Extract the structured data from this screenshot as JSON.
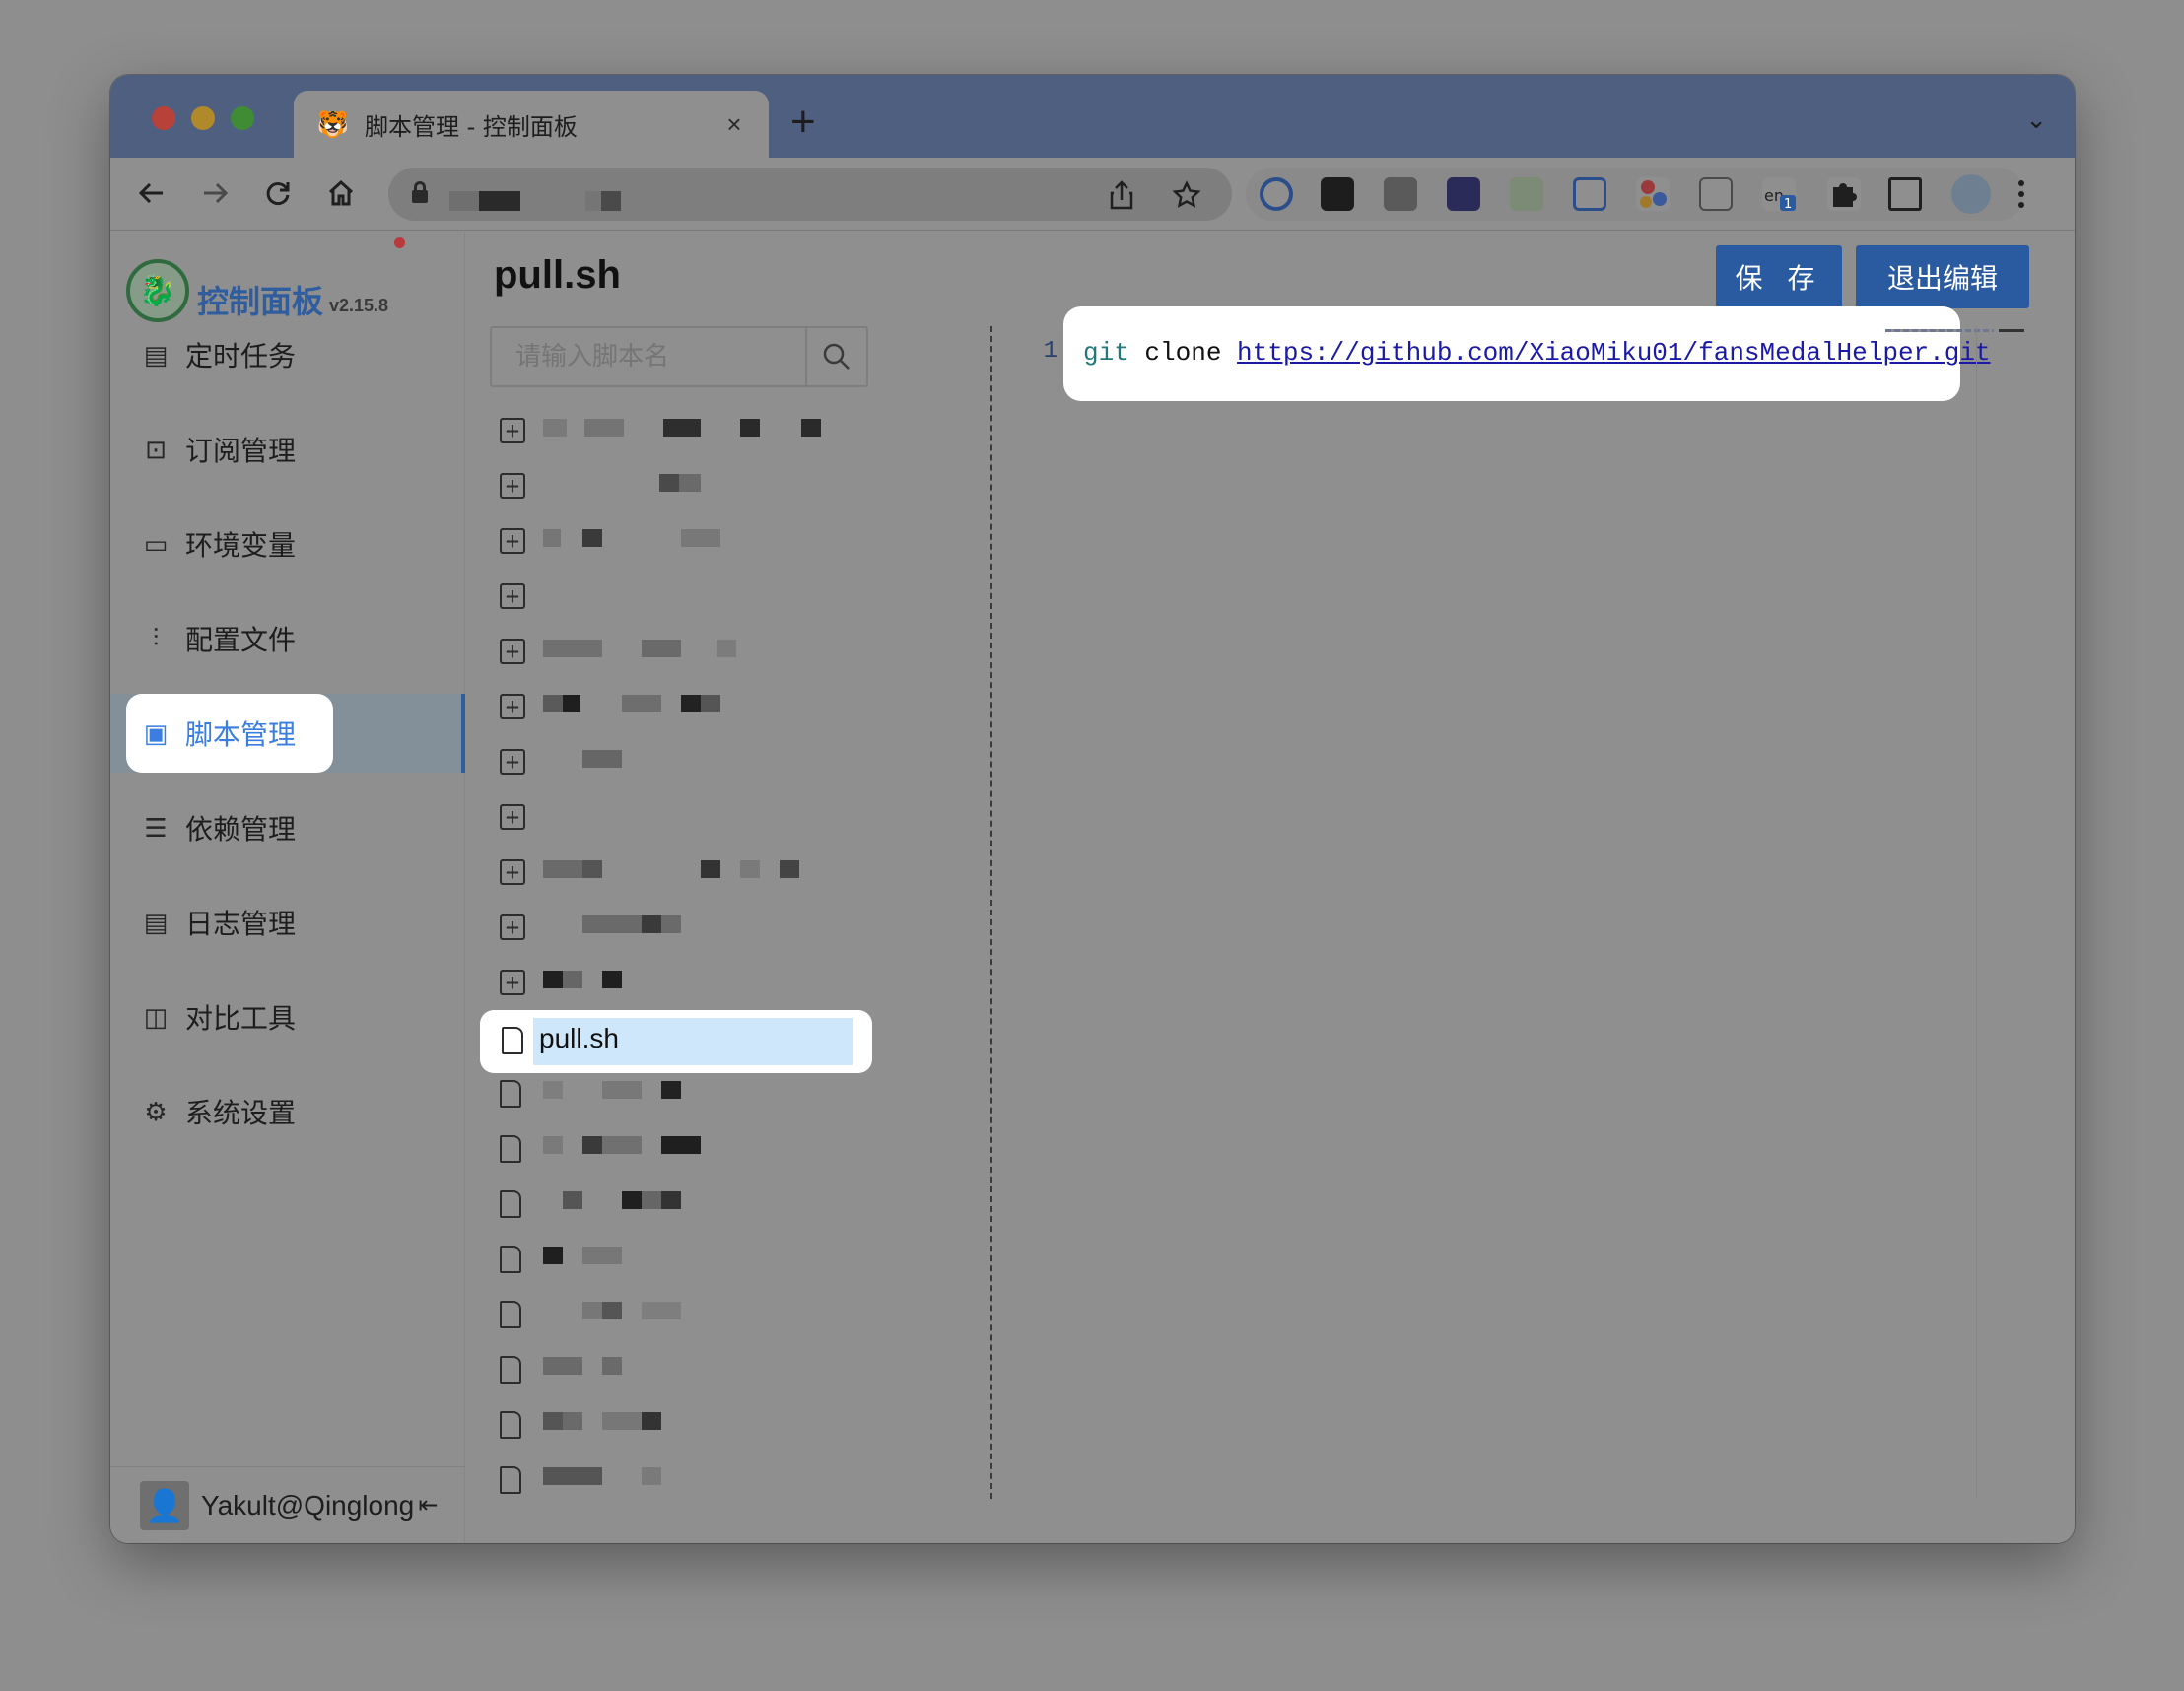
{
  "browser": {
    "tab_title": "脚本管理 - 控制面板",
    "tab_close": "×",
    "new_tab": "+",
    "tab_menu": "⌄"
  },
  "icons": {
    "back": "back-arrow-icon",
    "forward": "forward-arrow-icon",
    "reload": "reload-icon",
    "home": "home-icon",
    "share": "share-icon",
    "bookmark": "star-icon",
    "search": "search-icon"
  },
  "sidebar": {
    "brand": "控制面板",
    "version": "v2.15.8",
    "items": [
      {
        "label": "定时任务",
        "icon": "calendar-icon",
        "glyph": "▤"
      },
      {
        "label": "订阅管理",
        "icon": "subscription-icon",
        "glyph": "⊡"
      },
      {
        "label": "环境变量",
        "icon": "monitor-icon",
        "glyph": "▭"
      },
      {
        "label": "配置文件",
        "icon": "sliders-icon",
        "glyph": "⫶"
      },
      {
        "label": "脚本管理",
        "icon": "terminal-icon",
        "glyph": "▣"
      },
      {
        "label": "依赖管理",
        "icon": "list-icon",
        "glyph": "☰"
      },
      {
        "label": "日志管理",
        "icon": "log-icon",
        "glyph": "▤"
      },
      {
        "label": "对比工具",
        "icon": "diff-icon",
        "glyph": "◫"
      },
      {
        "label": "系统设置",
        "icon": "gear-icon",
        "glyph": "⚙"
      }
    ],
    "active_index": 4,
    "user": "Yakult@Qinglong",
    "collapse_glyph": "⇤"
  },
  "main": {
    "title": "pull.sh",
    "save_label": "保 存",
    "exit_label": "退出编辑",
    "search_placeholder": "请输入脚本名",
    "selected_file": "pull.sh",
    "editor": {
      "line_number": "1",
      "cmd": "git",
      "arg": " clone ",
      "url": "https://github.com/XiaoMiku01/fansMedalHelper.git"
    }
  },
  "colors": {
    "accent": "#2a5aa0",
    "active_text": "#3b7de0",
    "selection": "#cfe7fb"
  }
}
